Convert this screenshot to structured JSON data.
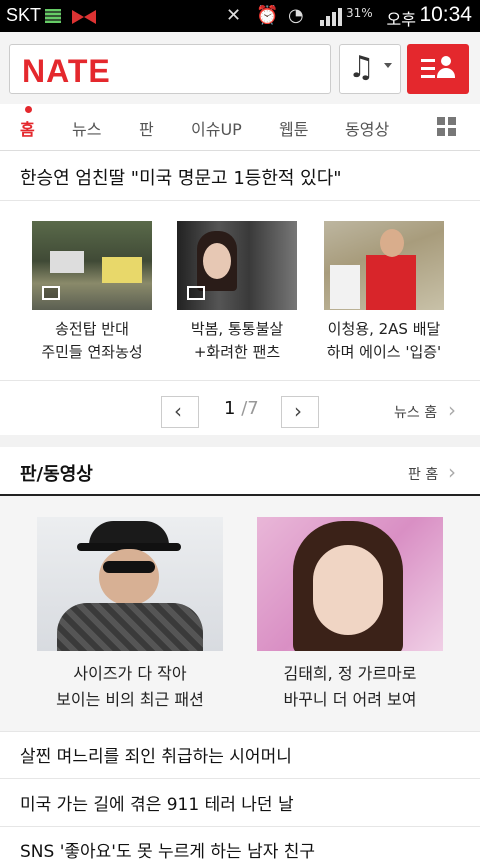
{
  "status_bar": {
    "carrier": "SKT",
    "battery": "31%",
    "ampm": "오후",
    "time": "10:34"
  },
  "header": {
    "logo": "NATE",
    "music_icon": "music-note-icon",
    "my_icon": "my-menu-icon"
  },
  "tabs": [
    {
      "label": "홈",
      "active": true
    },
    {
      "label": "뉴스"
    },
    {
      "label": "판"
    },
    {
      "label": "이슈UP"
    },
    {
      "label": "웹툰"
    },
    {
      "label": "동영상"
    }
  ],
  "headline": "한승연 엄친딸 \"미국 명문고 1등한적 있다\"",
  "news_cards": [
    {
      "line1": "송전탑 반대",
      "line2": "주민들 연좌농성"
    },
    {
      "line1": "박봄, 통통불살",
      "line2": "+화려한 팬츠"
    },
    {
      "line1": "이청용, 2AS 배달",
      "line2": "하며 에이스 '입증'"
    }
  ],
  "pager": {
    "current": "1",
    "total": "/7",
    "prev": "‹",
    "next": "›"
  },
  "news_home_link": "뉴스 홈",
  "pan_section": {
    "title": "판/동영상",
    "home_link": "판 홈",
    "cards": [
      {
        "line1": "사이즈가 다 작아",
        "line2": "보이는 비의 최근 패션"
      },
      {
        "line1": "김태희, 정 가르마로",
        "line2": "바꾸니 더 어려 보여"
      }
    ]
  },
  "list": [
    "살찐 며느리를 죄인 취급하는 시어머니",
    "미국 가는 길에 겪은 911 테러 나던 날",
    "SNS '좋아요'도 못 누르게 하는 남자 친구"
  ]
}
